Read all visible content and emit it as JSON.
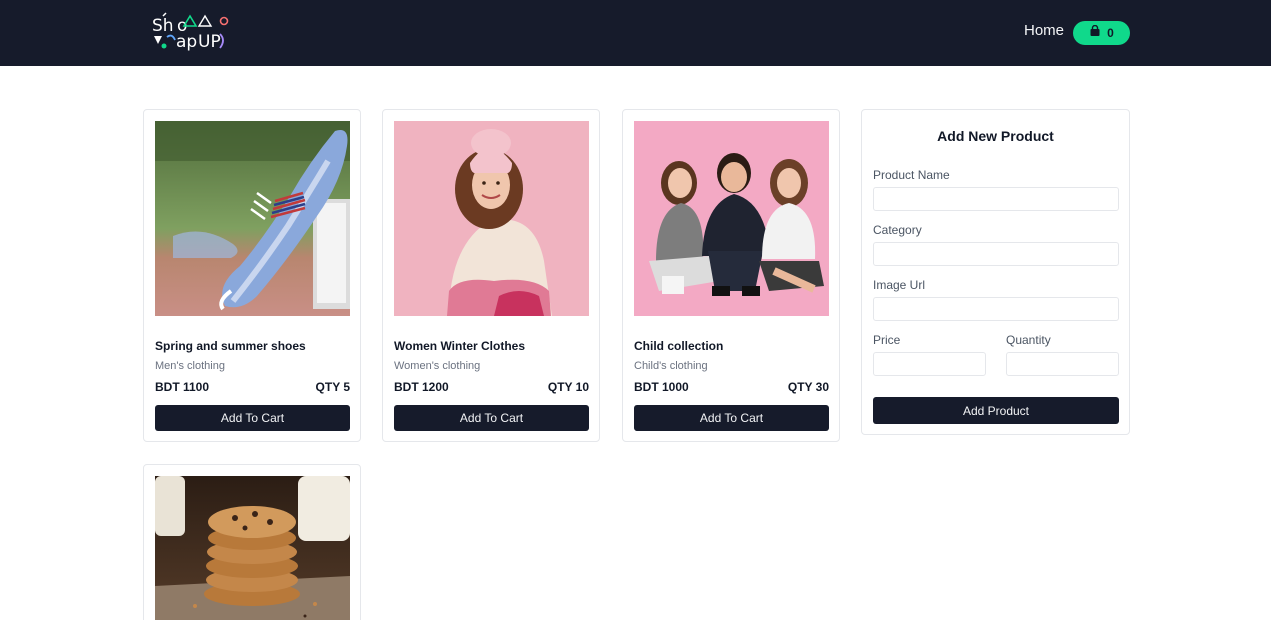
{
  "nav": {
    "logo_alt": "ShopUP",
    "home_label": "Home",
    "cart_count": "0"
  },
  "products": [
    {
      "name": "Spring and summer shoes",
      "category": "Men's clothing",
      "price": "BDT 1100",
      "qty": "QTY 5",
      "button": "Add To Cart"
    },
    {
      "name": "Women Winter Clothes",
      "category": "Women's clothing",
      "price": "BDT 1200",
      "qty": "QTY 10",
      "button": "Add To Cart"
    },
    {
      "name": "Child collection",
      "category": "Child's clothing",
      "price": "BDT 1000",
      "qty": "QTY 30",
      "button": "Add To Cart"
    }
  ],
  "form": {
    "title": "Add New Product",
    "product_name_label": "Product Name",
    "category_label": "Category",
    "image_url_label": "Image Url",
    "price_label": "Price",
    "quantity_label": "Quantity",
    "submit_label": "Add Product"
  },
  "colors": {
    "navbar": "#161b2b",
    "accent": "#10d98b",
    "button": "#161b2b"
  }
}
